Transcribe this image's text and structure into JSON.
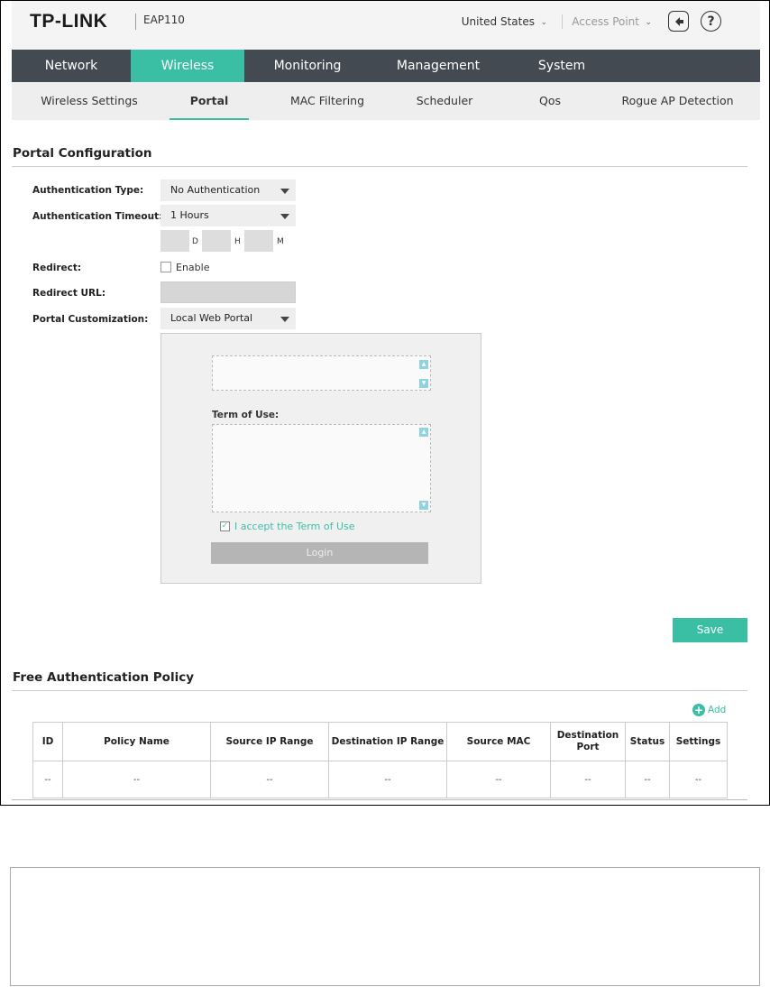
{
  "header": {
    "logo": "TP-LINK",
    "model": "EAP110",
    "country": "United States",
    "mode": "Access Point",
    "help_symbol": "?"
  },
  "main_nav": [
    {
      "label": "Network",
      "active": false
    },
    {
      "label": "Wireless",
      "active": true
    },
    {
      "label": "Monitoring",
      "active": false
    },
    {
      "label": "Management",
      "active": false
    },
    {
      "label": "System",
      "active": false
    }
  ],
  "sub_nav": [
    {
      "label": "Wireless Settings",
      "active": false
    },
    {
      "label": "Portal",
      "active": true
    },
    {
      "label": "MAC Filtering",
      "active": false
    },
    {
      "label": "Scheduler",
      "active": false
    },
    {
      "label": "Qos",
      "active": false
    },
    {
      "label": "Rogue AP Detection",
      "active": false
    }
  ],
  "portal_config": {
    "title": "Portal Configuration",
    "auth_type_label": "Authentication Type:",
    "auth_type_value": "No Authentication",
    "auth_timeout_label": "Authentication Timeout:",
    "auth_timeout_value": "1 Hours",
    "unit_d": "D",
    "unit_h": "H",
    "unit_m": "M",
    "redirect_label": "Redirect:",
    "redirect_enable": "Enable",
    "redirect_url_label": "Redirect URL:",
    "customization_label": "Portal Customization:",
    "customization_value": "Local Web Portal",
    "preview": {
      "term_of_use_label": "Term of Use:",
      "accept_label": "I accept the Term of Use",
      "accept_checked": true,
      "login_label": "Login",
      "check_mark": "✓",
      "scroll_up": "▲",
      "scroll_down": "▼"
    },
    "save_label": "Save"
  },
  "free_auth_policy": {
    "title": "Free Authentication Policy",
    "add_label": "Add",
    "add_symbol": "+",
    "columns": [
      "ID",
      "Policy Name",
      "Source IP Range",
      "Destination IP Range",
      "Source MAC",
      "Destination Port",
      "Status",
      "Settings"
    ],
    "rows": [
      [
        "--",
        "--",
        "--",
        "--",
        "--",
        "--",
        "--",
        "--"
      ]
    ]
  },
  "colors": {
    "accent": "#3bbfa4",
    "nav_bg": "#444a52"
  },
  "icons": {
    "logout": "logout-icon",
    "help": "help-icon",
    "add": "plus-circle-icon",
    "dropdown": "chevron-down-icon"
  }
}
